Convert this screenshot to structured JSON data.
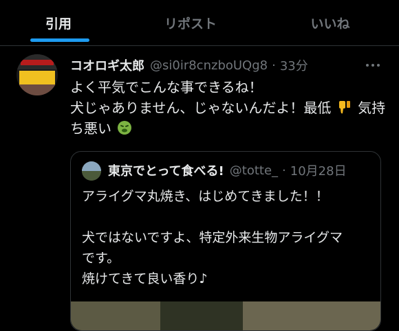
{
  "tabs": [
    {
      "label": "引用",
      "active": true
    },
    {
      "label": "リポスト",
      "active": false
    },
    {
      "label": "いいね",
      "active": false
    }
  ],
  "tweet": {
    "display_name": "コオロギ太郎",
    "handle": "@si0ir8cnzboUQg8",
    "time": "33分",
    "lines": [
      "よく平気でこんな事できるね！",
      [
        "犬じゃありません、じゃないんだよ！最低",
        "気持"
      ],
      [
        "ち悪い",
        ""
      ]
    ],
    "emojis": [
      "thumbs-down-icon",
      "nauseated-face-icon"
    ]
  },
  "quote": {
    "display_name": "東京でとって食べる!",
    "handle": "@totte_",
    "time": "10月28日",
    "lines": [
      "アライグマ丸焼き、はじめてきました！！",
      "",
      "犬ではないですよ、特定外来生物アライグマ",
      "です。",
      "焼けてきて良い香り♪"
    ]
  },
  "colors": {
    "accent": "#1d9bf0",
    "muted": "#71767b",
    "text": "#e7e9ea",
    "border": "#2f3336"
  }
}
